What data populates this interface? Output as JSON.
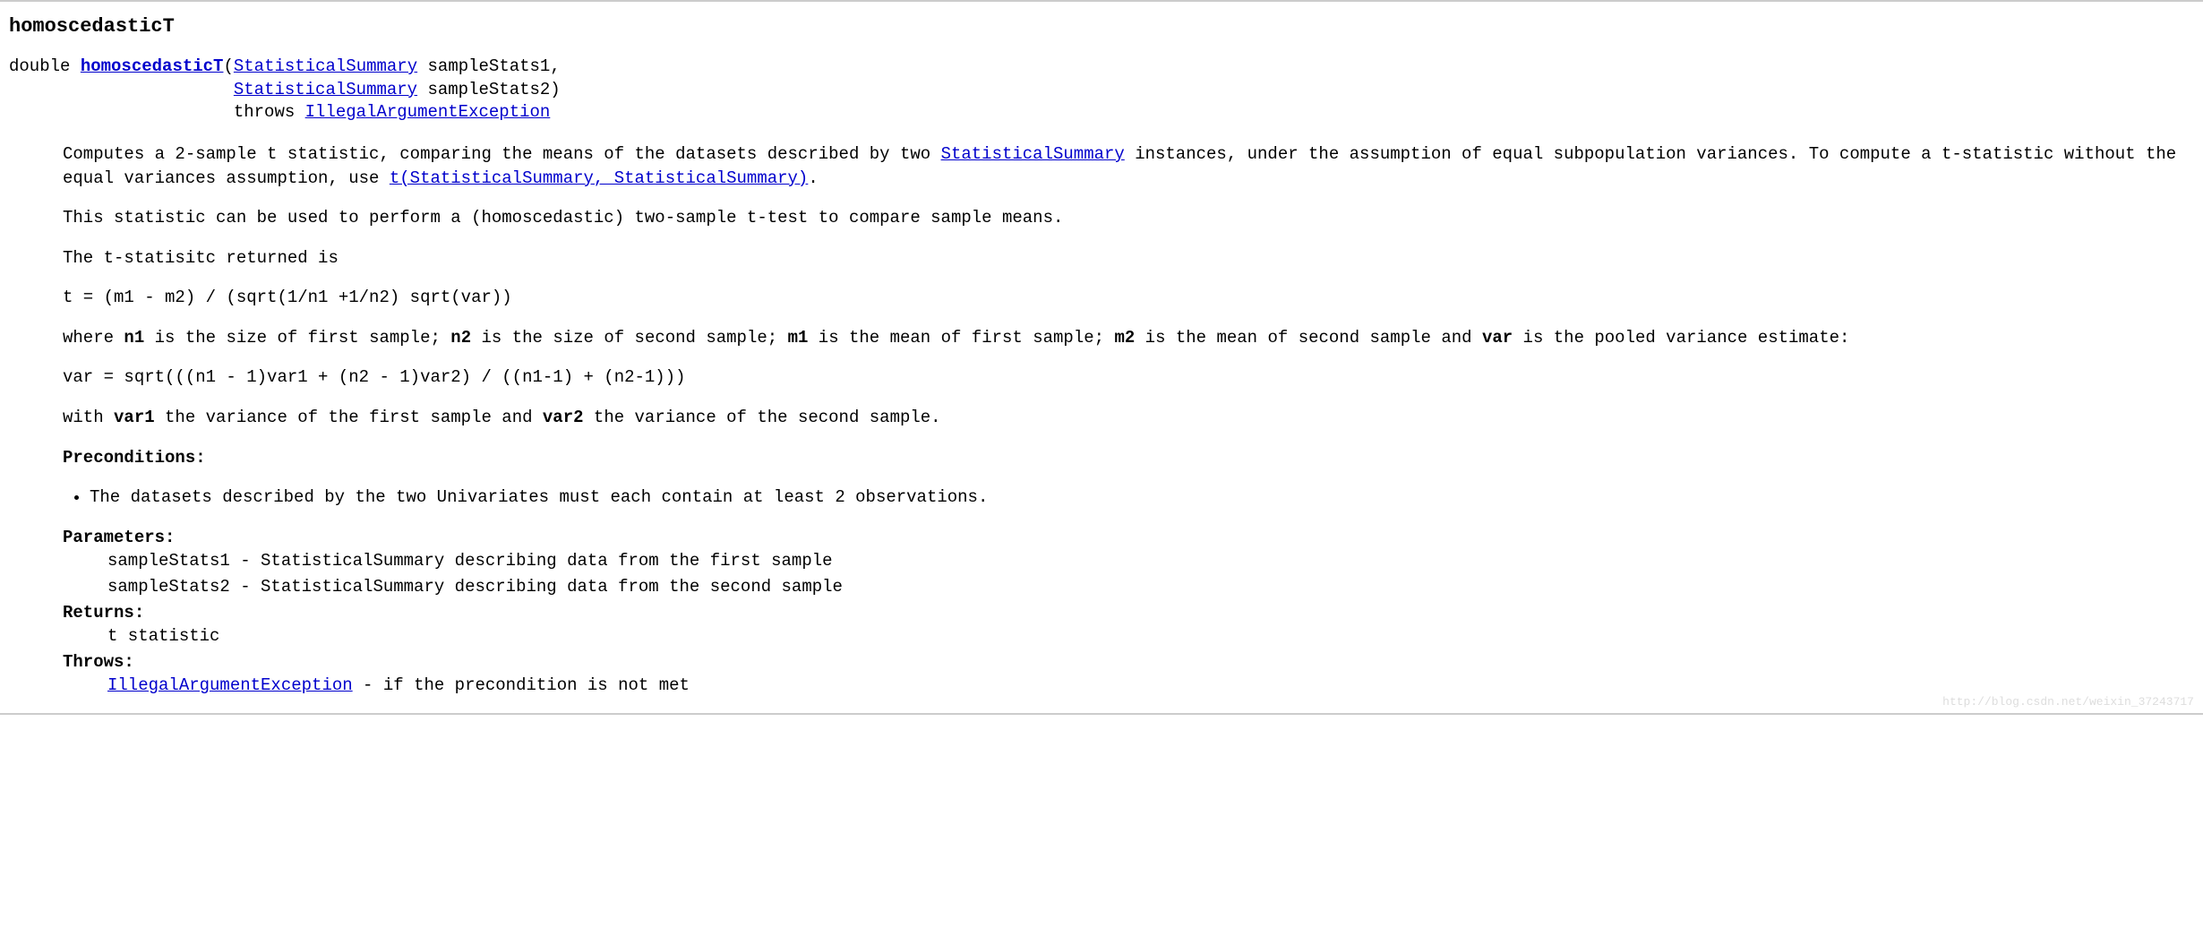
{
  "method": {
    "name": "homoscedasticT",
    "returnType": "double ",
    "methodLink": "homoscedasticT",
    "openParen": "(",
    "param1Type": "StatisticalSummary",
    "param1Name": " sampleStats1,",
    "param2Indent": "                      ",
    "param2Type": "StatisticalSummary",
    "param2Name": " sampleStats2)",
    "throwsIndent": "                      throws ",
    "throwsType": "IllegalArgumentException"
  },
  "desc": {
    "p1_a": "Computes a 2-sample t statistic, comparing the means of the datasets described by two ",
    "p1_link1": "StatisticalSummary",
    "p1_b": " instances, under the assumption of equal subpopulation variances. To compute a t-statistic without the equal variances assumption, use ",
    "p1_link2": "t(StatisticalSummary, StatisticalSummary)",
    "p1_c": ".",
    "p2": "This statistic can be used to perform a (homoscedastic) two-sample t-test to compare sample means.",
    "p3": "The t-statisitc returned is",
    "formula1": "t = (m1 - m2) / (sqrt(1/n1 +1/n2) sqrt(var))",
    "p4_a": "where ",
    "p4_n1": "n1",
    "p4_b": " is the size of first sample; ",
    "p4_n2": "n2",
    "p4_c": " is the size of second sample; ",
    "p4_m1": "m1",
    "p4_d": " is the mean of first sample; ",
    "p4_m2": "m2",
    "p4_e": " is the mean of second sample and ",
    "p4_var": "var",
    "p4_f": " is the pooled variance estimate:",
    "formula2": "var = sqrt(((n1 - 1)var1 + (n2 - 1)var2) / ((n1-1) + (n2-1)))",
    "p5_a": "with ",
    "p5_var1": "var1",
    "p5_b": " the variance of the first sample and ",
    "p5_var2": "var2",
    "p5_c": " the variance of the second sample.",
    "preconditions_label": "Preconditions:",
    "precond_item1": "The datasets described by the two Univariates must each contain at least 2 observations."
  },
  "dl": {
    "parameters_label": "Parameters:",
    "param1": "sampleStats1 - StatisticalSummary describing data from the first sample",
    "param2": "sampleStats2 - StatisticalSummary describing data from the second sample",
    "returns_label": "Returns:",
    "returns_value": "t statistic",
    "throws_label": "Throws:",
    "throws_link": "IllegalArgumentException",
    "throws_text": " - if the precondition is not met"
  },
  "watermark": "http://blog.csdn.net/weixin_37243717"
}
